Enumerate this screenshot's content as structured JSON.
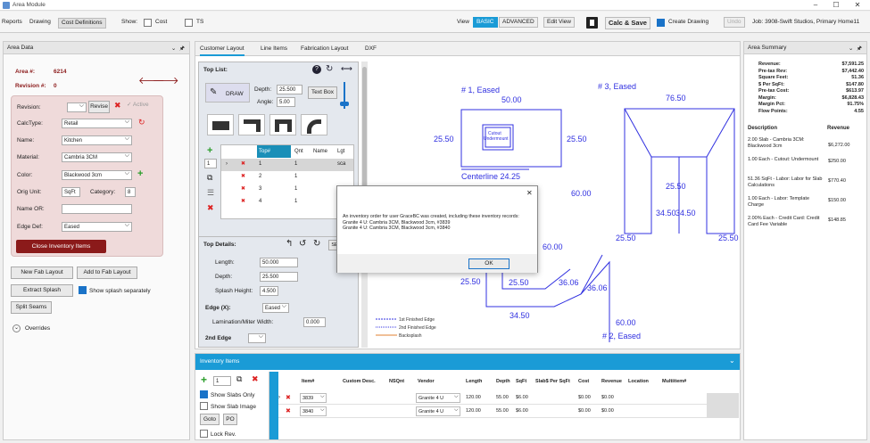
{
  "window": {
    "title": "Area Module"
  },
  "menu": {
    "reports": "Reports",
    "drawing": "Drawing",
    "cost_definitions": "Cost Definitions",
    "show": "Show:",
    "cost": "Cost",
    "ts": "TS",
    "view": "View",
    "basic": "BASIC",
    "advanced": "ADVANCED",
    "edit_view": "Edit View",
    "calc_save": "Calc & Save",
    "create_drawing": "Create Drawing",
    "undo": "Undo",
    "job": "Job: 3908-Swift Studios, Primary Home11"
  },
  "area_data": {
    "header": "Area Data",
    "pin": "⊻ ⊞",
    "area_label": "Area #:",
    "area_num": "6214",
    "rev_label": "Revision #:",
    "rev_num": "0",
    "revision_label": "Revision:",
    "revise": "Revise",
    "active": "Active",
    "calctype_label": "CalcType:",
    "calctype": "Retail",
    "name_label": "Name:",
    "name": "Kitchen",
    "material_label": "Material:",
    "material": "Cambria 3CM",
    "color_label": "Color:",
    "color": "Blackwood 3cm",
    "orig_unit_label": "Orig Unit:",
    "orig_unit": "SqFt",
    "category_label": "Category:",
    "category": "8",
    "name_or_label": "Name OR:",
    "edge_label": "Edge Def:",
    "edge": "Eased",
    "close_inv": "Close Inventory Items",
    "new_fab": "New Fab Layout",
    "add_fab": "Add to Fab Layout",
    "extract_splash": "Extract Splash",
    "show_splash": "Show splash separately",
    "split_seams": "Split Seams",
    "overrides": "Overrides"
  },
  "tabs": [
    "Customer Layout",
    "Line Items",
    "Fabrication Layout",
    "DXF"
  ],
  "top_list": {
    "header": "Top List:",
    "draw": "DRAW",
    "depth_label": "Depth:",
    "depth": "25.500",
    "angle_label": "Angle:",
    "angle": "5.00",
    "textbox": "Text Box",
    "cols": [
      "Top#",
      "Qnt",
      "Name",
      "Lgt"
    ],
    "rows": [
      [
        "1",
        "1",
        "",
        "sca"
      ],
      [
        "2",
        "1",
        "",
        " "
      ],
      [
        "3",
        "1",
        "",
        " "
      ],
      [
        "4",
        "1",
        "",
        " "
      ]
    ],
    "spin": "1"
  },
  "top_details": {
    "header": "Top Details:",
    "length_label": "Length:",
    "length": "50.000",
    "depth_label": "Depth:",
    "depth": "25.500",
    "splash_label": "Splash Height:",
    "splash": "4.500",
    "edge_label": "Edge (X):",
    "edge": "Eased",
    "lam_label": "Lamination/Miter Width:",
    "lam": "0.000",
    "edge2_label": "2nd Edge",
    "se": "SE"
  },
  "drawing": {
    "labels": [
      "# 1, Eased",
      "# 3, Eased",
      "50.00",
      "25.50",
      "25.50",
      "Cutout",
      "Undermount",
      "Centerline 24.25",
      "76.50",
      "60.00",
      "25.50",
      "34.50",
      "34.50",
      "25.50",
      "25.50",
      "25.50",
      "60.00",
      "25.50",
      "36.06",
      "36.06",
      "34.50",
      "60.00",
      "# 2, Eased"
    ],
    "legend": [
      "1st Finished Edge",
      "2nd Finished Edge",
      "Backsplash"
    ]
  },
  "dialog": {
    "message": "An inventory order for user GraceBC was created, including these inventory records:",
    "line1": "Granite 4 U: Cambria 3CM, Blackwood 3cm, #3839",
    "line2": "Granite 4 U: Cambria 3CM, Blackwood 3cm, #3840",
    "ok": "OK"
  },
  "area_summary": {
    "header": "Area Summary",
    "stats": [
      [
        "Revenue:",
        "$7,591.25"
      ],
      [
        "Pre-tax Rev:",
        "$7,442.40"
      ],
      [
        "Square Feet:",
        "51.36"
      ],
      [
        "$ Per SqFt:",
        "$147.80"
      ],
      [
        "Pre-tax Cost:",
        "$613.97"
      ],
      [
        "Margin:",
        "$6,828.43"
      ],
      [
        "Margin Pct:",
        "91.75%"
      ],
      [
        "Flow Points:",
        "4.55"
      ]
    ],
    "desc_h": "Description",
    "rev_h": "Revenue",
    "items": [
      [
        "2.00 Slab - Cambria 3CM: Blackwood 3cm",
        "$6,272.00"
      ],
      [
        "1.00 Each - Cutout: Undermount",
        "$250.00"
      ],
      [
        "51.36 SqFt - Labor: Labor for Slab Calculations",
        "$770.40"
      ],
      [
        "1.00 Each - Labor: Template Charge",
        "$150.00"
      ],
      [
        "2.00% Each - Credit Card: Credit Card Fee Variable",
        "$148.85"
      ]
    ]
  },
  "inventory": {
    "header": "Inventory Items",
    "spin": "1",
    "show_slabs": "Show Slabs Only",
    "show_slab_image": "Show Slab Image",
    "goto": "Goto",
    "po": "PO",
    "lock_rev": "Lock Rev.",
    "cols": [
      "Item#",
      "Custom Desc.",
      "NSQnt",
      "Vendor",
      "Length",
      "Depth",
      "SqFt",
      "Slab$ Per SqFt",
      "Cost",
      "Revenue",
      "Location",
      "Multiitem#"
    ],
    "rows": [
      [
        "3839",
        "",
        "",
        "Granite 4 U",
        "120.00",
        "55.00",
        "$6.00",
        "",
        "$0.00",
        "$0.00",
        "",
        ""
      ],
      [
        "3840",
        "",
        "",
        "Granite 4 U",
        "120.00",
        "55.00",
        "$6.00",
        "",
        "$0.00",
        "$0.00",
        "",
        ""
      ]
    ]
  },
  "colors": {
    "accent": "#1a9bd6",
    "teal": "#1a8fb8",
    "drawing": "#3030e0",
    "panel_pink": "#efdada",
    "dark_red": "#8b1a1a"
  }
}
